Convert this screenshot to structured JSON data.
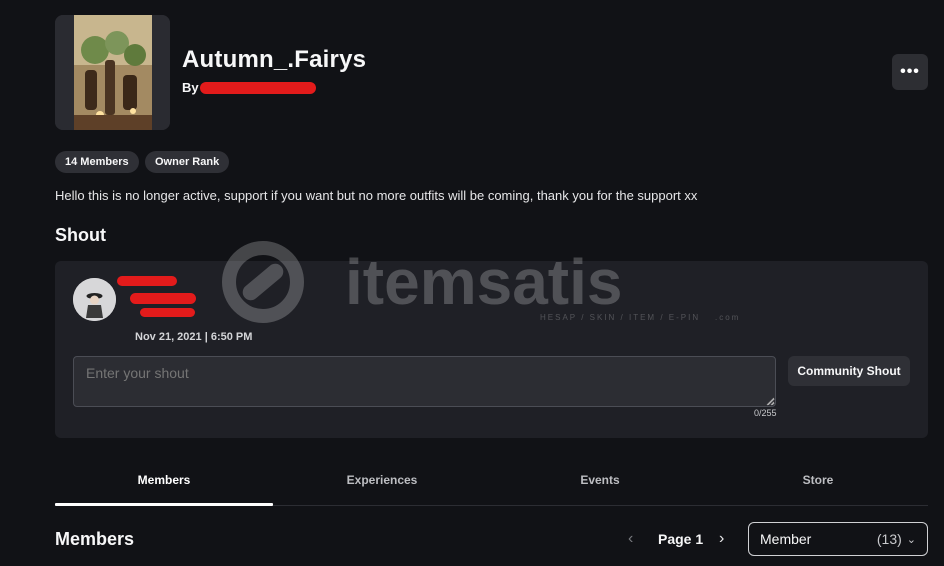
{
  "group": {
    "name": "Autumn_.Fairys",
    "by_label": "By",
    "description": "Hello this is no longer active, support if you want but no more outfits will be coming, thank you for the support xx"
  },
  "chips": [
    "14 Members",
    "Owner Rank"
  ],
  "more_button": "•••",
  "shout": {
    "title": "Shout",
    "date": "Nov 21, 2021 | 6:50 PM",
    "input_placeholder": "Enter your shout",
    "counter": "0/255",
    "button_label": "Community Shout"
  },
  "tabs": [
    {
      "label": "Members",
      "active": true
    },
    {
      "label": "Experiences",
      "active": false
    },
    {
      "label": "Events",
      "active": false
    },
    {
      "label": "Store",
      "active": false
    }
  ],
  "members": {
    "title": "Members",
    "page_label": "Page 1",
    "role_label": "Member",
    "role_count": "(13)"
  },
  "watermark": {
    "brand": "itemsatis",
    "tagline": "HESAP / SKIN / ITEM / E-PIN",
    "tld": ".com"
  },
  "colors": {
    "background": "#111216",
    "panel": "#1f2026",
    "chip": "#2f3036",
    "redaction": "#e31b1b"
  }
}
